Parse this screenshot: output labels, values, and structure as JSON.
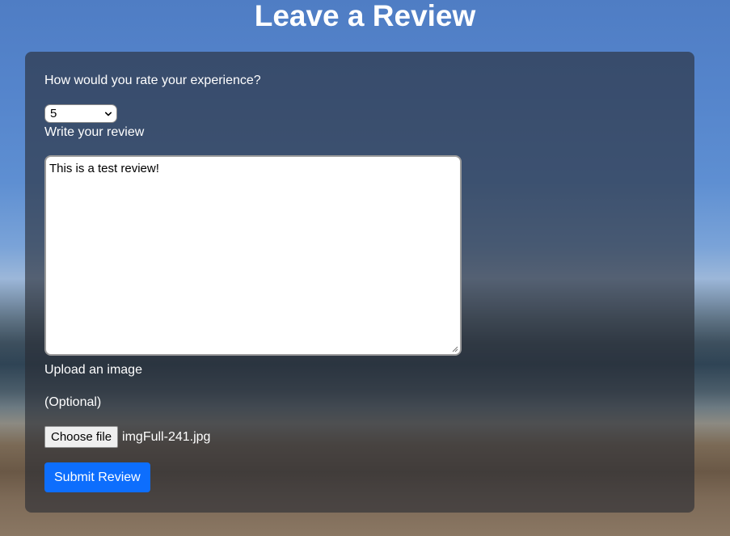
{
  "page": {
    "title": "Leave a Review"
  },
  "form": {
    "rating_label": "How would you rate your experience?",
    "rating_value": "5",
    "review_label": "Write your review",
    "review_text": "This is a test review!",
    "upload_label": "Upload an image",
    "optional_label": "(Optional)",
    "choose_file_label": "Choose file",
    "file_name": "imgFull-241.jpg",
    "submit_label": "Submit Review"
  },
  "colors": {
    "submit_button": "#0d6efd",
    "card_background": "rgba(40,44,52,0.62)",
    "text": "#ffffff"
  },
  "icons": {
    "select_arrow": "chevron-down-icon",
    "textarea_resize": "resize-grip-icon"
  }
}
